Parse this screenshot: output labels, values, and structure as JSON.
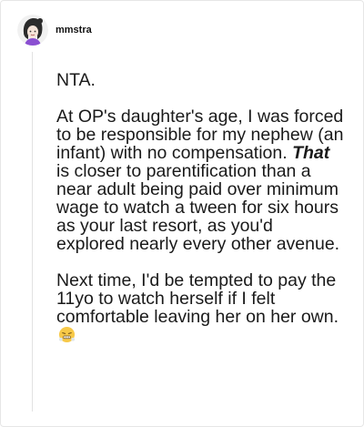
{
  "post": {
    "username": "mmstra",
    "paragraph1": "NTA.",
    "paragraph2_before": "At OP's daughter's age, I was forced to be responsible for my nephew (an infant) with no compensation. ",
    "paragraph2_emphasis": "That",
    "paragraph2_after": " is closer to parentification than a near adult being paid over minimum wage to watch a tween for six hours as your last resort, as you'd explored nearly every other avenue.",
    "paragraph3": "Next time, I'd be tempted to pay the 11yo to watch herself if I felt comfortable leaving her on her own.",
    "end_emoji": "grimacing-steam-face-icon"
  },
  "colors": {
    "text": "#1a1a1a",
    "border": "#e6e6e6",
    "thread_line": "#e2e2e2"
  }
}
